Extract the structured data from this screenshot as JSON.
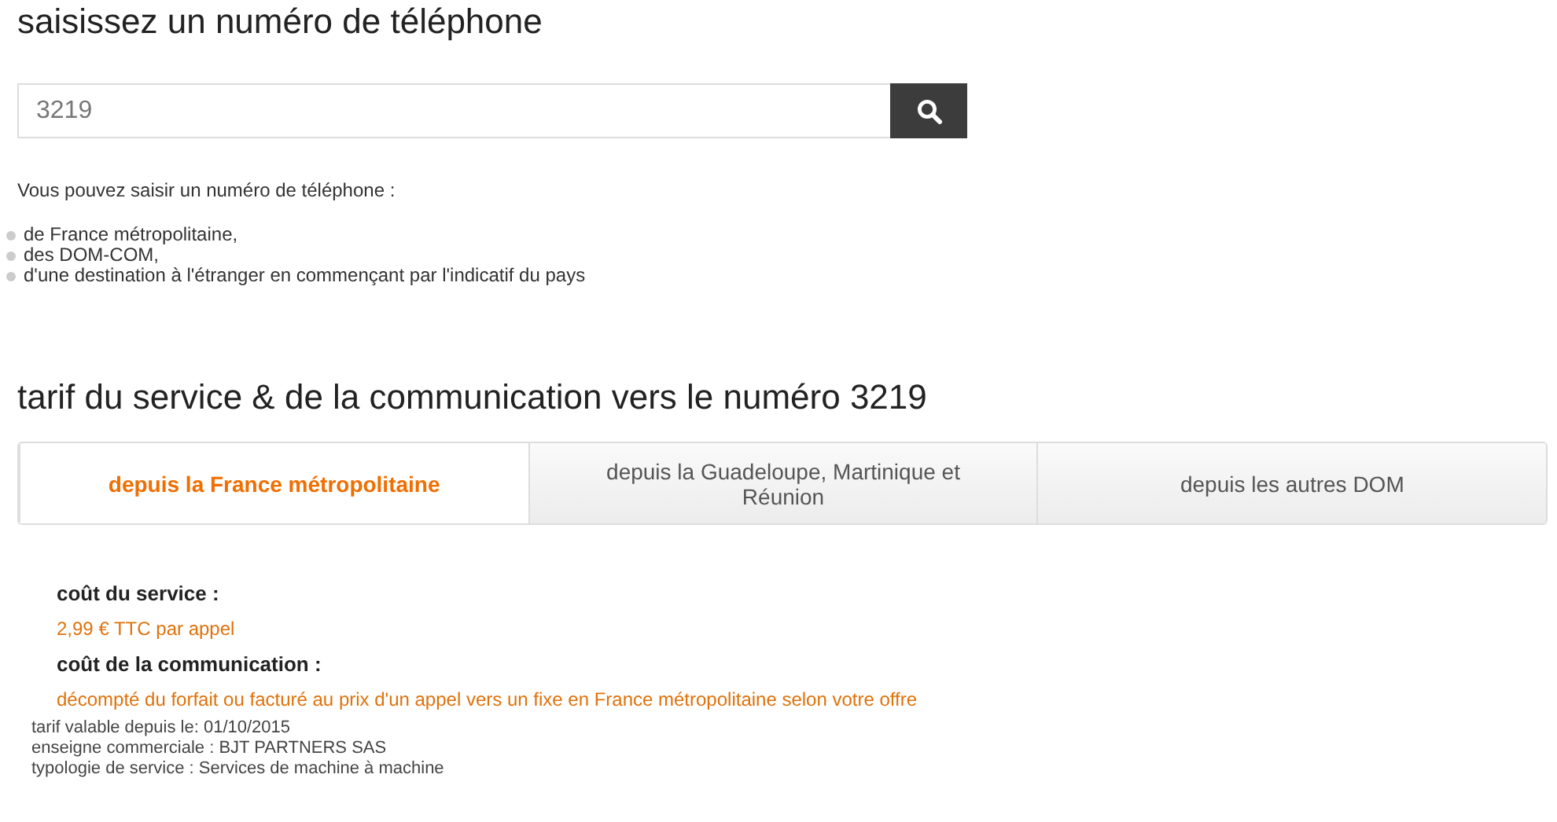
{
  "search_title": "saisissez un numéro de téléphone",
  "search": {
    "value": "3219"
  },
  "intro": "Vous pouvez saisir un numéro de téléphone :",
  "options": [
    "de France métropolitaine,",
    "des DOM-COM,",
    "d'une destination à l'étranger en commençant par l'indicatif du pays"
  ],
  "tariff_title": "tarif du service & de la communication vers le numéro 3219",
  "tabs": [
    {
      "label": "depuis la France métropolitaine",
      "selected": true
    },
    {
      "label": "depuis la Guadeloupe, Martinique et Réunion",
      "selected": false
    },
    {
      "label": "depuis les autres DOM",
      "selected": false
    }
  ],
  "costs": [
    {
      "label": "coût du service :",
      "value": "2,99 € TTC par appel"
    },
    {
      "label": "coût de la communication :",
      "value": "décompté du forfait ou facturé au prix d'un appel vers un fixe en France métropolitaine selon votre offre"
    }
  ],
  "notes": [
    "tarif valable depuis le: 01/10/2015",
    "enseigne commerciale : BJT PARTNERS SAS",
    "typologie de service : Services de machine à machine"
  ]
}
